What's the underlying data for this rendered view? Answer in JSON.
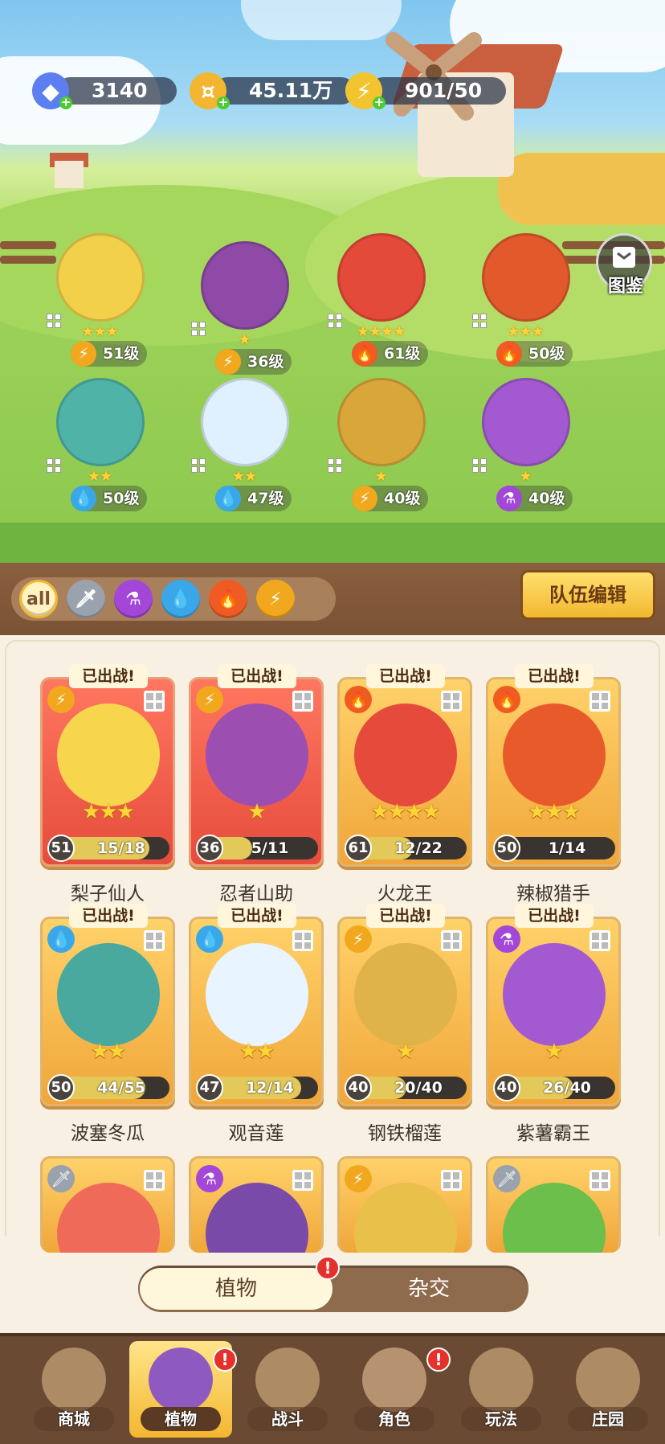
{
  "currencies": [
    {
      "name": "gems",
      "icon": "diamond-icon",
      "value": "3140",
      "color": "#5b7ff0"
    },
    {
      "name": "coins",
      "icon": "coin-icon",
      "value": "45.11万",
      "color": "#f2b630"
    },
    {
      "name": "energy",
      "icon": "lightning-icon",
      "value": "901/50",
      "color": "#f2c530"
    }
  ],
  "codex_label": "图鉴",
  "scene_team": [
    {
      "level": "51级",
      "stars": 3,
      "element": "lightning"
    },
    {
      "level": "36级",
      "stars": 1,
      "element": "lightning"
    },
    {
      "level": "61级",
      "stars": 4,
      "element": "fire"
    },
    {
      "level": "50级",
      "stars": 3,
      "element": "fire"
    },
    {
      "level": "50级",
      "stars": 2,
      "element": "water"
    },
    {
      "level": "47级",
      "stars": 2,
      "element": "water"
    },
    {
      "level": "40级",
      "stars": 1,
      "element": "lightning"
    },
    {
      "level": "40级",
      "stars": 1,
      "element": "poison"
    }
  ],
  "filters": [
    {
      "id": "all",
      "label": "all",
      "icon": "all-filter",
      "selected": true
    },
    {
      "id": "sword",
      "label": "",
      "icon": "sword-icon",
      "selected": false
    },
    {
      "id": "poison",
      "label": "",
      "icon": "potion-icon",
      "selected": false
    },
    {
      "id": "water",
      "label": "",
      "icon": "water-drop-icon",
      "selected": false
    },
    {
      "id": "fire",
      "label": "",
      "icon": "fire-icon",
      "selected": false
    },
    {
      "id": "lightning",
      "label": "",
      "icon": "lightning-icon",
      "selected": false
    }
  ],
  "team_edit_label": "队伍编辑",
  "deployed_label": "已出战!",
  "cards": [
    {
      "name": "梨子仙人",
      "level": "51",
      "progress": "15/18",
      "fill": 0.83,
      "stars": 3,
      "element": "lightning",
      "red": true
    },
    {
      "name": "忍者山助",
      "level": "36",
      "progress": "5/11",
      "fill": 0.45,
      "stars": 1,
      "element": "lightning",
      "red": true
    },
    {
      "name": "火龙王",
      "level": "61",
      "progress": "12/22",
      "fill": 0.55,
      "stars": 4,
      "element": "fire",
      "red": false
    },
    {
      "name": "辣椒猎手",
      "level": "50",
      "progress": "1/14",
      "fill": 0.07,
      "stars": 3,
      "element": "fire",
      "red": false
    },
    {
      "name": "波塞冬瓜",
      "level": "50",
      "progress": "44/55",
      "fill": 0.8,
      "stars": 2,
      "element": "water",
      "red": false
    },
    {
      "name": "观音莲",
      "level": "47",
      "progress": "12/14",
      "fill": 0.86,
      "stars": 2,
      "element": "water",
      "red": false
    },
    {
      "name": "钢铁榴莲",
      "level": "40",
      "progress": "20/40",
      "fill": 0.5,
      "stars": 1,
      "element": "lightning",
      "red": false
    },
    {
      "name": "紫薯霸王",
      "level": "40",
      "progress": "26/40",
      "fill": 0.65,
      "stars": 1,
      "element": "poison",
      "red": false
    }
  ],
  "partial_cards": [
    {
      "element": "sword"
    },
    {
      "element": "poison"
    },
    {
      "element": "lightning"
    },
    {
      "element": "sword"
    }
  ],
  "toggle": {
    "plants": "植物",
    "hybrid": "杂交",
    "alert": "!"
  },
  "nav": [
    {
      "id": "shop",
      "label": "商城",
      "alert": false,
      "active": false
    },
    {
      "id": "plants",
      "label": "植物",
      "alert": true,
      "active": true
    },
    {
      "id": "battle",
      "label": "战斗",
      "alert": false,
      "active": false
    },
    {
      "id": "character",
      "label": "角色",
      "alert": true,
      "active": false
    },
    {
      "id": "gameplay",
      "label": "玩法",
      "alert": false,
      "active": false
    },
    {
      "id": "manor",
      "label": "庄园",
      "alert": false,
      "active": false
    }
  ],
  "colors": {
    "lightning": "#f2a81e",
    "fire": "#ef5b23",
    "water": "#3aa8e8",
    "poison": "#a247d8",
    "sword": "#9aa2ad"
  }
}
